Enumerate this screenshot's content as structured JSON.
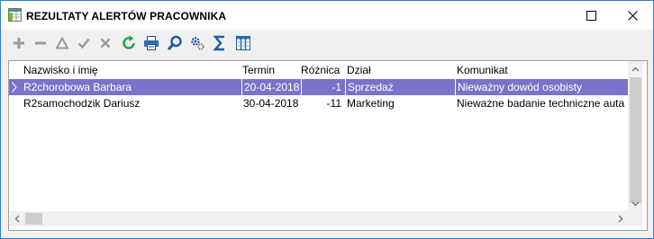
{
  "window": {
    "title": "REZULTATY ALERTÓW PRACOWNIKA",
    "accent": "#2a7fd4"
  },
  "toolbar": {
    "buttons": [
      {
        "icon": "add-icon"
      },
      {
        "icon": "remove-icon"
      },
      {
        "icon": "edit-triangle-icon"
      },
      {
        "icon": "confirm-check-icon"
      },
      {
        "icon": "cancel-x-icon"
      },
      {
        "icon": "refresh-icon"
      },
      {
        "icon": "print-icon"
      },
      {
        "icon": "search-icon"
      },
      {
        "icon": "settings-icon"
      },
      {
        "icon": "sum-icon"
      },
      {
        "icon": "columns-icon"
      }
    ]
  },
  "table": {
    "columns": {
      "name": "Nazwisko i imię",
      "date": "Termin",
      "diff": "Różnica",
      "dept": "Dział",
      "message": "Komunikat"
    },
    "rows": [
      {
        "name": "R2chorobowa Barbara",
        "date": "20-04-2018",
        "diff": "-1",
        "dept": "Sprzedaż",
        "message": "Nieważny dowód osobisty"
      },
      {
        "name": "R2samochodzik Dariusz",
        "date": "30-04-2018",
        "diff": "-11",
        "dept": "Marketing",
        "message": "Nieważne badanie techniczne auta"
      }
    ],
    "selected_row": 0,
    "selection_color": "#7b73c9"
  }
}
